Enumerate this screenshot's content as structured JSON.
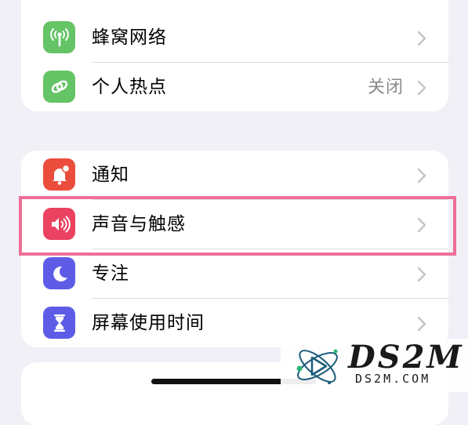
{
  "groups": {
    "network": {
      "items": [
        {
          "label": "蜂窝网络",
          "icon": "cellular-antenna-icon",
          "color": "#65c466"
        },
        {
          "label": "个人热点",
          "value": "关闭",
          "icon": "hotspot-link-icon",
          "color": "#65c466"
        }
      ]
    },
    "system": {
      "items": [
        {
          "label": "通知",
          "icon": "notification-bell-icon",
          "color": "#eb4d3d"
        },
        {
          "label": "声音与触感",
          "icon": "speaker-sound-icon",
          "color": "#ea4260"
        },
        {
          "label": "专注",
          "icon": "moon-icon",
          "color": "#5e5ce6"
        },
        {
          "label": "屏幕使用时间",
          "icon": "hourglass-icon",
          "color": "#5e5ce6"
        }
      ]
    }
  },
  "highlight_color": "#ee6f99",
  "watermark": {
    "title": "DS2M",
    "subtitle": "DS2M.COM"
  }
}
